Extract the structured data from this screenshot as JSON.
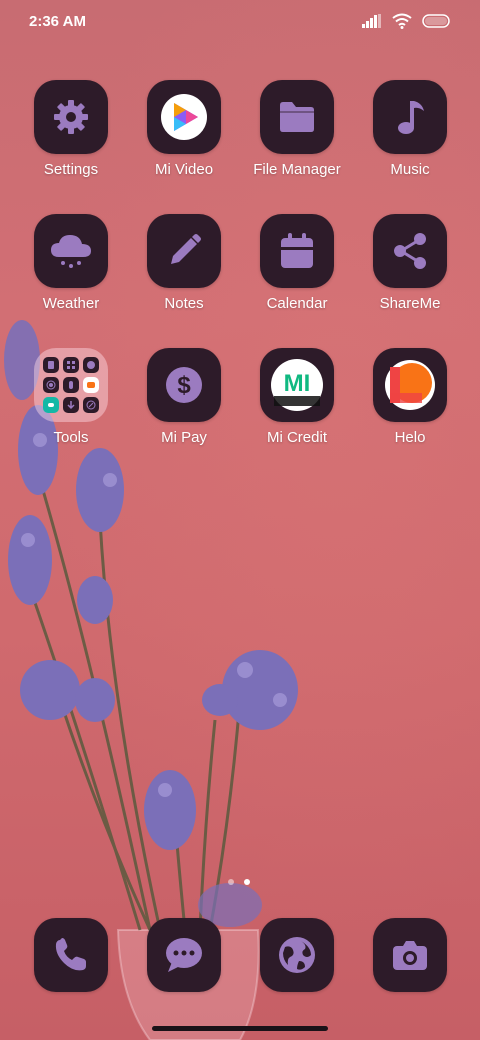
{
  "status": {
    "time": "2:36 AM"
  },
  "apps": [
    {
      "label": "Settings",
      "icon": "gear-icon"
    },
    {
      "label": "Mi Video",
      "icon": "play-icon"
    },
    {
      "label": "File Manager",
      "icon": "folder-icon"
    },
    {
      "label": "Music",
      "icon": "music-note-icon"
    },
    {
      "label": "Weather",
      "icon": "cloud-icon"
    },
    {
      "label": "Notes",
      "icon": "pencil-icon"
    },
    {
      "label": "Calendar",
      "icon": "calendar-icon"
    },
    {
      "label": "ShareMe",
      "icon": "share-icon"
    },
    {
      "label": "Tools",
      "icon": "folder-grid-icon"
    },
    {
      "label": "Mi Pay",
      "icon": "dollar-icon"
    },
    {
      "label": "Mi Credit",
      "icon": "mi-credit-logo",
      "logo_text": "MI"
    },
    {
      "label": "Helo",
      "icon": "helo-logo"
    }
  ],
  "dock": [
    {
      "icon": "phone-icon"
    },
    {
      "icon": "message-icon"
    },
    {
      "icon": "globe-icon"
    },
    {
      "icon": "camera-icon"
    }
  ],
  "pager": {
    "pages": 2,
    "active": 2
  },
  "colors": {
    "tile": "#2d1b29",
    "icon": "#9b7bc0",
    "wallpaper": "#d06a6e",
    "lavender": "#7b6fb8"
  }
}
